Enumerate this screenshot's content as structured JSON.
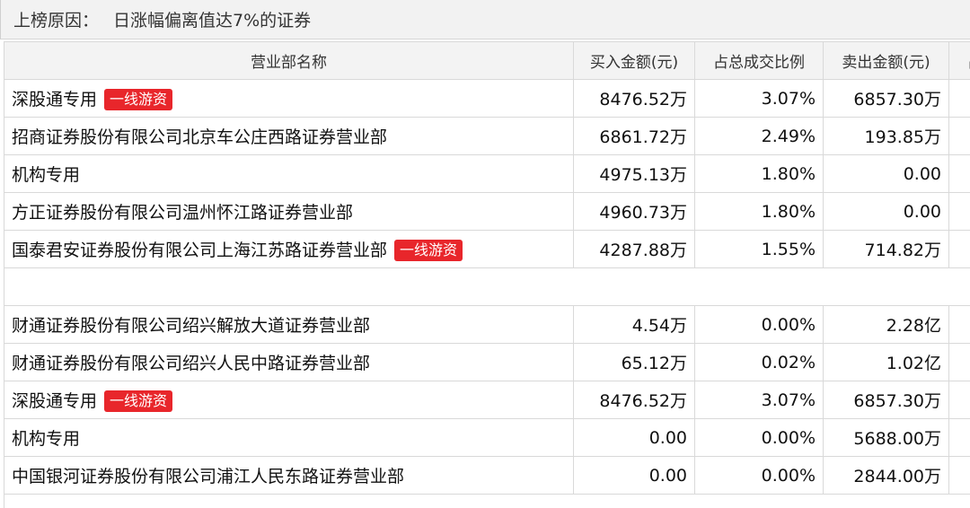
{
  "reason": {
    "label": "上榜原因：",
    "value": "日涨幅偏离值达7%的证券"
  },
  "columns": {
    "name": "营业部名称",
    "buy": "买入金额(元)",
    "buy_ratio": "占总成交比例",
    "sell": "卖出金额(元)",
    "sell_ratio": "占"
  },
  "tag_label": "一线游资",
  "buy_rows": [
    {
      "name": "深股通专用",
      "tag": "一线游资",
      "buy": "8476.52万",
      "buy_ratio": "3.07%",
      "sell": "6857.30万"
    },
    {
      "name": "招商证券股份有限公司北京车公庄西路证券营业部",
      "tag": "",
      "buy": "6861.72万",
      "buy_ratio": "2.49%",
      "sell": "193.85万"
    },
    {
      "name": "机构专用",
      "tag": "",
      "buy": "4975.13万",
      "buy_ratio": "1.80%",
      "sell": "0.00"
    },
    {
      "name": "方正证券股份有限公司温州怀江路证券营业部",
      "tag": "",
      "buy": "4960.73万",
      "buy_ratio": "1.80%",
      "sell": "0.00"
    },
    {
      "name": "国泰君安证券股份有限公司上海江苏路证券营业部",
      "tag": "一线游资",
      "buy": "4287.88万",
      "buy_ratio": "1.55%",
      "sell": "714.82万"
    }
  ],
  "sell_rows": [
    {
      "name": "财通证券股份有限公司绍兴解放大道证券营业部",
      "tag": "",
      "buy": "4.54万",
      "buy_ratio": "0.00%",
      "sell": "2.28亿"
    },
    {
      "name": "财通证券股份有限公司绍兴人民中路证券营业部",
      "tag": "",
      "buy": "65.12万",
      "buy_ratio": "0.02%",
      "sell": "1.02亿"
    },
    {
      "name": "深股通专用",
      "tag": "一线游资",
      "buy": "8476.52万",
      "buy_ratio": "3.07%",
      "sell": "6857.30万"
    },
    {
      "name": "机构专用",
      "tag": "",
      "buy": "0.00",
      "buy_ratio": "0.00%",
      "sell": "5688.00万"
    },
    {
      "name": "中国银河证券股份有限公司浦江人民东路证券营业部",
      "tag": "",
      "buy": "0.00",
      "buy_ratio": "0.00%",
      "sell": "2844.00万"
    }
  ],
  "colors": {
    "tag_bg": "#e8262b",
    "header_bg": "#f3f3f3",
    "border": "#d9d9d9"
  }
}
